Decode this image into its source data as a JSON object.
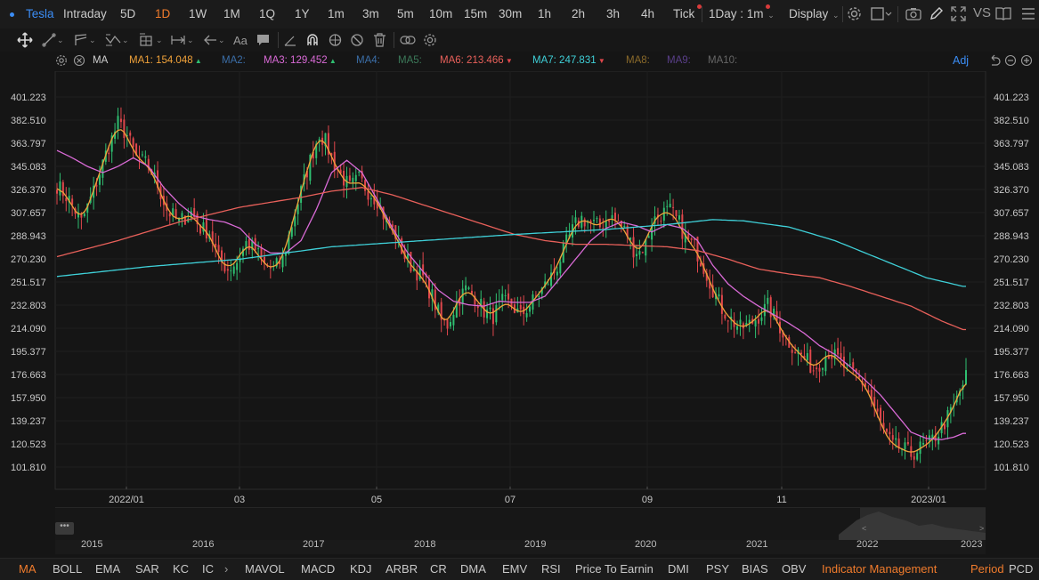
{
  "symbol": "Tesla",
  "periods": [
    {
      "label": "Intraday",
      "active": false
    },
    {
      "label": "5D",
      "active": false
    },
    {
      "label": "1D",
      "active": true
    },
    {
      "label": "1W",
      "active": false
    },
    {
      "label": "1M",
      "active": false
    },
    {
      "label": "1Q",
      "active": false
    },
    {
      "label": "1Y",
      "active": false
    },
    {
      "label": "1m",
      "active": false
    },
    {
      "label": "3m",
      "active": false
    },
    {
      "label": "5m",
      "active": false
    },
    {
      "label": "10m",
      "active": false
    },
    {
      "label": "15m",
      "active": false
    },
    {
      "label": "30m",
      "active": false
    },
    {
      "label": "1h",
      "active": false
    },
    {
      "label": "2h",
      "active": false
    },
    {
      "label": "3h",
      "active": false
    },
    {
      "label": "4h",
      "active": false
    },
    {
      "label": "Tick",
      "active": false
    }
  ],
  "interval_selector": "1Day : 1m",
  "display_label": "Display",
  "vs_label": "VS",
  "ma_indicator": {
    "name": "MA",
    "items": [
      {
        "label": "MA1:",
        "value": "154.048",
        "arrow": "up",
        "color": "#f0a23a"
      },
      {
        "label": "MA2:",
        "value": "",
        "arrow": "",
        "color": "#3b6ea8"
      },
      {
        "label": "MA3:",
        "value": "129.452",
        "arrow": "up",
        "color": "#d96ad6"
      },
      {
        "label": "MA4:",
        "value": "",
        "arrow": "",
        "color": "#3b6ea8"
      },
      {
        "label": "MA5:",
        "value": "",
        "arrow": "",
        "color": "#3c7a5a"
      },
      {
        "label": "MA6:",
        "value": "213.466",
        "arrow": "down",
        "color": "#e8605a"
      },
      {
        "label": "MA7:",
        "value": "247.831",
        "arrow": "down",
        "color": "#3fd0d8"
      },
      {
        "label": "MA8:",
        "value": "",
        "arrow": "",
        "color": "#8a6a2a"
      },
      {
        "label": "MA9:",
        "value": "",
        "arrow": "",
        "color": "#5a3f8a"
      },
      {
        "label": "MA10:",
        "value": "",
        "arrow": "",
        "color": "#666666"
      }
    ],
    "adj_label": "Adj"
  },
  "chart_data": {
    "type": "candlestick",
    "y_ticks": [
      "401.223",
      "382.510",
      "363.797",
      "345.083",
      "326.370",
      "307.657",
      "288.943",
      "270.230",
      "251.517",
      "232.803",
      "214.090",
      "195.377",
      "176.663",
      "157.950",
      "139.237",
      "120.523",
      "101.810"
    ],
    "ylim": [
      85,
      415
    ],
    "x_ticks": [
      "2022/01",
      "03",
      "05",
      "07",
      "09",
      "11",
      "2023/01"
    ],
    "colors": {
      "up": "#2fbf71",
      "down": "#e0474c",
      "ma1": "#f0a23a",
      "ma3": "#d96ad6",
      "ma6": "#e8605a",
      "ma7": "#3fd0d8"
    },
    "last_values": {
      "MA1": 154.048,
      "MA3": 129.452,
      "MA6": 213.466,
      "MA7": 247.831
    },
    "close_anchors": [
      [
        0,
        330
      ],
      [
        4,
        318
      ],
      [
        8,
        300
      ],
      [
        12,
        325
      ],
      [
        16,
        355
      ],
      [
        20,
        380
      ],
      [
        23,
        370
      ],
      [
        26,
        352
      ],
      [
        30,
        346
      ],
      [
        33,
        330
      ],
      [
        36,
        310
      ],
      [
        40,
        300
      ],
      [
        44,
        308
      ],
      [
        47,
        295
      ],
      [
        50,
        292
      ],
      [
        53,
        270
      ],
      [
        56,
        262
      ],
      [
        59,
        268
      ],
      [
        62,
        283
      ],
      [
        65,
        278
      ],
      [
        68,
        265
      ],
      [
        71,
        262
      ],
      [
        74,
        270
      ],
      [
        77,
        298
      ],
      [
        80,
        325
      ],
      [
        83,
        350
      ],
      [
        86,
        372
      ],
      [
        88,
        365
      ],
      [
        90,
        352
      ],
      [
        93,
        338
      ],
      [
        96,
        328
      ],
      [
        99,
        335
      ],
      [
        102,
        325
      ],
      [
        105,
        318
      ],
      [
        108,
        300
      ],
      [
        111,
        290
      ],
      [
        114,
        272
      ],
      [
        117,
        262
      ],
      [
        120,
        255
      ],
      [
        123,
        240
      ],
      [
        126,
        220
      ],
      [
        128,
        217
      ],
      [
        131,
        235
      ],
      [
        134,
        246
      ],
      [
        137,
        240
      ],
      [
        140,
        228
      ],
      [
        143,
        224
      ],
      [
        146,
        235
      ],
      [
        149,
        233
      ],
      [
        152,
        224
      ],
      [
        155,
        233
      ],
      [
        158,
        242
      ],
      [
        161,
        252
      ],
      [
        164,
        264
      ],
      [
        167,
        283
      ],
      [
        170,
        298
      ],
      [
        172,
        303
      ],
      [
        175,
        299
      ],
      [
        178,
        296
      ],
      [
        181,
        305
      ],
      [
        184,
        300
      ],
      [
        187,
        290
      ],
      [
        189,
        278
      ],
      [
        191,
        276
      ],
      [
        193,
        283
      ],
      [
        195,
        300
      ],
      [
        198,
        307
      ],
      [
        201,
        309
      ],
      [
        204,
        299
      ],
      [
        206,
        287
      ],
      [
        209,
        280
      ],
      [
        212,
        264
      ],
      [
        215,
        246
      ],
      [
        218,
        230
      ],
      [
        221,
        221
      ],
      [
        224,
        214
      ],
      [
        227,
        217
      ],
      [
        230,
        224
      ],
      [
        233,
        232
      ],
      [
        236,
        220
      ],
      [
        239,
        206
      ],
      [
        242,
        197
      ],
      [
        245,
        190
      ],
      [
        248,
        181
      ],
      [
        250,
        186
      ],
      [
        253,
        195
      ],
      [
        256,
        189
      ],
      [
        259,
        180
      ],
      [
        262,
        176
      ],
      [
        265,
        168
      ],
      [
        268,
        150
      ],
      [
        271,
        131
      ],
      [
        274,
        119
      ],
      [
        277,
        117
      ],
      [
        280,
        112
      ],
      [
        283,
        117
      ],
      [
        286,
        121
      ],
      [
        289,
        130
      ],
      [
        292,
        142
      ],
      [
        294,
        150
      ],
      [
        296,
        163
      ],
      [
        298,
        175
      ]
    ],
    "ma3_anchors": [
      [
        0,
        358
      ],
      [
        5,
        352
      ],
      [
        10,
        345
      ],
      [
        15,
        340
      ],
      [
        20,
        345
      ],
      [
        25,
        352
      ],
      [
        30,
        345
      ],
      [
        35,
        328
      ],
      [
        40,
        315
      ],
      [
        45,
        305
      ],
      [
        50,
        302
      ],
      [
        55,
        300
      ],
      [
        60,
        295
      ],
      [
        65,
        282
      ],
      [
        70,
        275
      ],
      [
        75,
        275
      ],
      [
        80,
        285
      ],
      [
        85,
        310
      ],
      [
        90,
        340
      ],
      [
        95,
        350
      ],
      [
        100,
        340
      ],
      [
        105,
        318
      ],
      [
        110,
        295
      ],
      [
        115,
        275
      ],
      [
        120,
        260
      ],
      [
        125,
        245
      ],
      [
        130,
        236
      ],
      [
        135,
        233
      ],
      [
        140,
        232
      ],
      [
        145,
        236
      ],
      [
        150,
        235
      ],
      [
        155,
        235
      ],
      [
        160,
        240
      ],
      [
        165,
        255
      ],
      [
        170,
        270
      ],
      [
        175,
        285
      ],
      [
        180,
        295
      ],
      [
        185,
        300
      ],
      [
        190,
        297
      ],
      [
        195,
        292
      ],
      [
        200,
        298
      ],
      [
        205,
        295
      ],
      [
        210,
        285
      ],
      [
        215,
        265
      ],
      [
        220,
        250
      ],
      [
        225,
        240
      ],
      [
        230,
        232
      ],
      [
        235,
        225
      ],
      [
        240,
        218
      ],
      [
        245,
        210
      ],
      [
        250,
        200
      ],
      [
        255,
        193
      ],
      [
        260,
        183
      ],
      [
        265,
        172
      ],
      [
        270,
        160
      ],
      [
        275,
        145
      ],
      [
        280,
        130
      ],
      [
        285,
        125
      ],
      [
        290,
        124
      ],
      [
        294,
        126
      ],
      [
        297,
        129
      ]
    ],
    "ma6_anchors": [
      [
        0,
        272
      ],
      [
        20,
        285
      ],
      [
        40,
        300
      ],
      [
        60,
        312
      ],
      [
        80,
        320
      ],
      [
        90,
        325
      ],
      [
        100,
        328
      ],
      [
        110,
        322
      ],
      [
        120,
        314
      ],
      [
        130,
        306
      ],
      [
        140,
        298
      ],
      [
        150,
        290
      ],
      [
        160,
        285
      ],
      [
        170,
        282
      ],
      [
        180,
        282
      ],
      [
        190,
        281
      ],
      [
        200,
        280
      ],
      [
        210,
        277
      ],
      [
        220,
        270
      ],
      [
        230,
        262
      ],
      [
        240,
        258
      ],
      [
        250,
        255
      ],
      [
        260,
        248
      ],
      [
        270,
        240
      ],
      [
        280,
        232
      ],
      [
        290,
        220
      ],
      [
        297,
        213
      ]
    ],
    "ma7_anchors": [
      [
        0,
        256
      ],
      [
        30,
        264
      ],
      [
        60,
        270
      ],
      [
        90,
        280
      ],
      [
        120,
        285
      ],
      [
        150,
        290
      ],
      [
        180,
        294
      ],
      [
        200,
        298
      ],
      [
        215,
        302
      ],
      [
        225,
        301
      ],
      [
        240,
        296
      ],
      [
        255,
        285
      ],
      [
        270,
        270
      ],
      [
        285,
        255
      ],
      [
        297,
        248
      ]
    ]
  },
  "navigator": {
    "years": [
      "2015",
      "2016",
      "2017",
      "2018",
      "2019",
      "2020",
      "2021",
      "2022",
      "2023"
    ]
  },
  "bottom_tabs": {
    "left": [
      "MA",
      "BOLL",
      "EMA",
      "SAR",
      "KC",
      "IC"
    ],
    "right": [
      "MAVOL",
      "MACD",
      "KDJ",
      "ARBR",
      "CR",
      "DMA",
      "EMV",
      "RSI",
      "Price To Earnin",
      "DMI",
      "PSY",
      "BIAS",
      "OBV"
    ],
    "indicator_management": "Indicator Management",
    "period_label": "Period",
    "pcd_label": "PCD"
  }
}
